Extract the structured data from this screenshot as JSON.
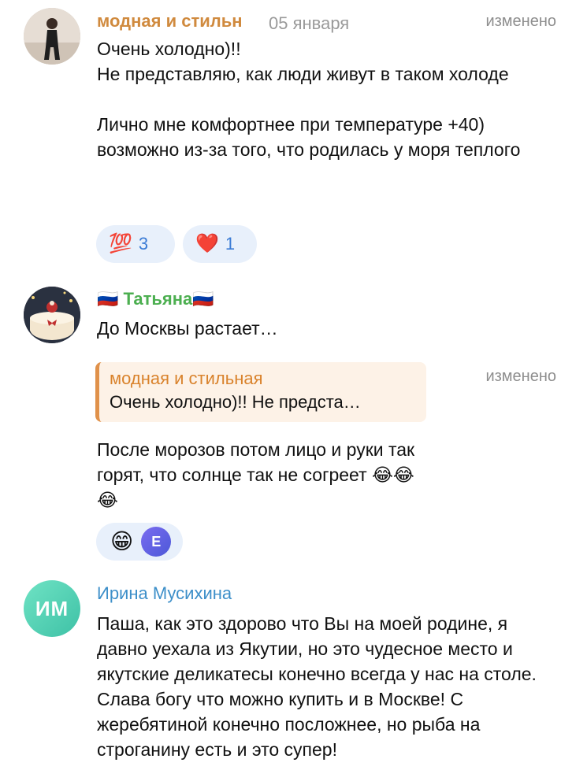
{
  "comments": [
    {
      "author": "модная и стильн",
      "date": "05 января",
      "edited": "изменено",
      "text": "Очень холодно)!!\nНе представляю, как люди живут в таком холоде\n\nЛично мне комфортнее при температуре +40) возможно из-за того, что родилась у моря теплого",
      "reactions": [
        {
          "emoji": "💯",
          "count": "3"
        },
        {
          "emoji": "❤️",
          "count": "1"
        }
      ]
    },
    {
      "author": "🇷🇺 Татьяна🇷🇺",
      "text": "До Москвы растает…",
      "reply": {
        "author": "модная и стильная",
        "text": "Очень холодно)!! Не предста…"
      },
      "edited": "изменено",
      "text2": "После морозов потом лицо и руки так горят, что  солнце  так не согреет 😂😂😂",
      "reactions": [
        {
          "emoji": "😁"
        },
        {
          "letter": "E"
        }
      ]
    },
    {
      "author": "Ирина Мусихина",
      "initials": "ИМ",
      "text": "Паша, как это здорово что Вы на моей родине, я давно уехала из Якутии, но это чудесное место и якутские деликатесы конечно всегда у нас на столе. Слава богу что можно купить и в Москве!  С жеребятиной конечно посложнее, но рыба на строганину есть и это супер!"
    }
  ],
  "colors": {
    "name1": "#d08a3e",
    "name2": "#4caf50",
    "name3": "#3d8fc9",
    "reaction_bg": "#e8f0fb",
    "reaction_count": "#3a7bd5",
    "reply_accent": "#e0914a"
  }
}
